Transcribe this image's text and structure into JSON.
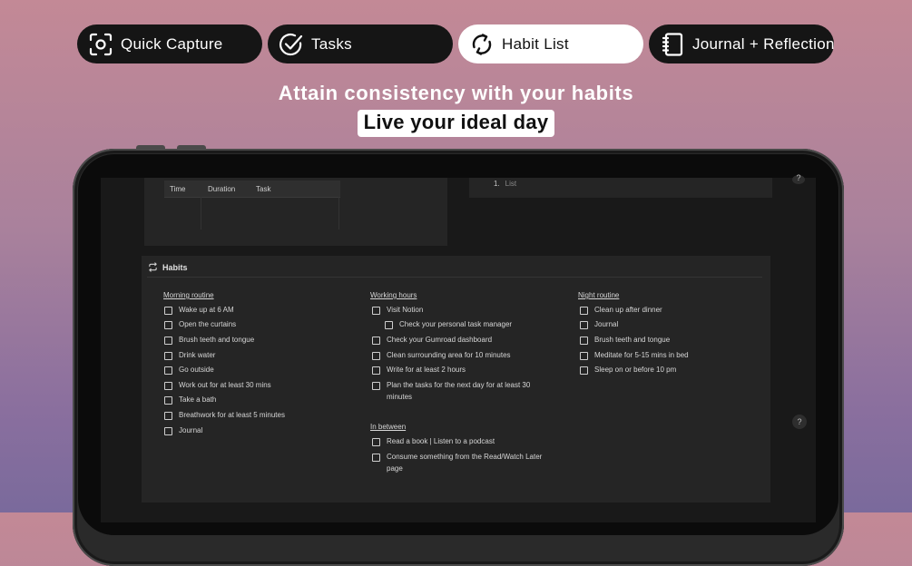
{
  "nav": {
    "tabs": [
      {
        "label": "Quick Capture",
        "icon": "camera-focus-icon"
      },
      {
        "label": "Tasks",
        "icon": "check-circle-icon"
      },
      {
        "label": "Habit List",
        "icon": "refresh-icon",
        "active": true
      },
      {
        "label": "Journal + Reflection",
        "icon": "notebook-icon"
      }
    ]
  },
  "hero": {
    "heading": "Attain consistency with your habits",
    "subheading": "Live your ideal day"
  },
  "schedule_table": {
    "columns": [
      "Time",
      "Duration",
      "Task"
    ]
  },
  "list_block": {
    "number": "1.",
    "placeholder": "List"
  },
  "habits": {
    "title": "Habits",
    "morning": {
      "heading": "Morning routine",
      "items": [
        "Wake up at 6 AM",
        "Open the curtains",
        "Brush teeth and tongue",
        "Drink water",
        "Go outside",
        "Work out for at least 30 mins",
        "Take a bath",
        "Breathwork for at least 5 minutes",
        "Journal"
      ]
    },
    "working": {
      "heading": "Working hours",
      "items": [
        "Visit Notion",
        "Check your personal task manager",
        "Check your Gumroad dashboard",
        "Clean surrounding area for 10 minutes",
        "Write for at least 2 hours",
        "Plan the tasks for the next day for at least 30 minutes"
      ]
    },
    "in_between": {
      "heading": "In between",
      "items": [
        "Read a book | Listen to a podcast",
        "Consume something from the Read/Watch Later page"
      ]
    },
    "night": {
      "heading": "Night routine",
      "items": [
        "Clean up after dinner",
        "Journal",
        "Brush teeth and tongue",
        "Meditate for 5-15 mins in bed",
        "Sleep on or before 10 pm"
      ]
    }
  },
  "help": {
    "label": "?"
  }
}
